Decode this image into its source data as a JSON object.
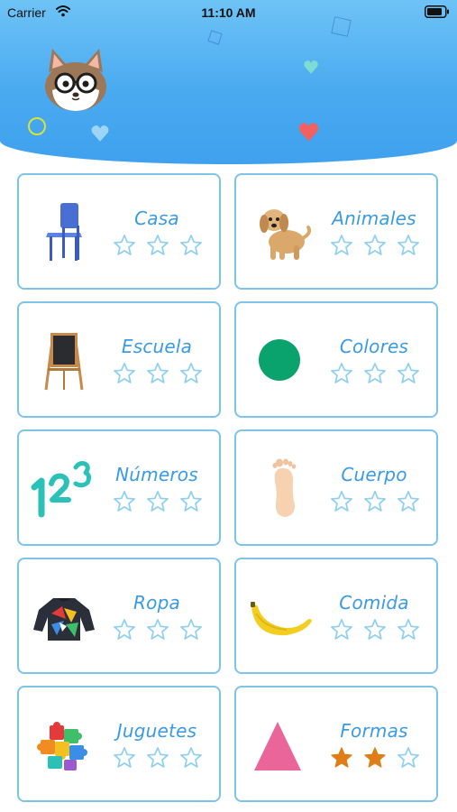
{
  "status_bar": {
    "carrier": "Carrier",
    "time": "11:10 AM",
    "wifi_icon": "wifi-icon",
    "battery_icon": "battery-icon"
  },
  "header": {
    "mascot_icon": "cat-mascot-with-glasses",
    "gradient_colors": [
      "#6ec3f6",
      "#3fa1ee"
    ]
  },
  "colors": {
    "card_border": "#7cc4ea",
    "title_text": "#3a9be2",
    "star_empty_stroke": "#8fd0f0",
    "star_filled": "#df7d16"
  },
  "categories": [
    {
      "title": "Casa",
      "image": "chair",
      "stars_earned": 0,
      "stars_total": 3
    },
    {
      "title": "Animales",
      "image": "puppy",
      "stars_earned": 0,
      "stars_total": 3
    },
    {
      "title": "Escuela",
      "image": "chalkboard-easel",
      "stars_earned": 0,
      "stars_total": 3
    },
    {
      "title": "Colores",
      "image": "green-circle",
      "stars_earned": 0,
      "stars_total": 3
    },
    {
      "title": "Números",
      "image": "numbers-123",
      "stars_earned": 0,
      "stars_total": 3
    },
    {
      "title": "Cuerpo",
      "image": "foot",
      "stars_earned": 0,
      "stars_total": 3
    },
    {
      "title": "Ropa",
      "image": "sweater",
      "stars_earned": 0,
      "stars_total": 3
    },
    {
      "title": "Comida",
      "image": "banana",
      "stars_earned": 0,
      "stars_total": 3
    },
    {
      "title": "Juguetes",
      "image": "puzzle-pieces",
      "stars_earned": 0,
      "stars_total": 3
    },
    {
      "title": "Formas",
      "image": "pink-triangle",
      "stars_earned": 2,
      "stars_total": 3
    }
  ]
}
